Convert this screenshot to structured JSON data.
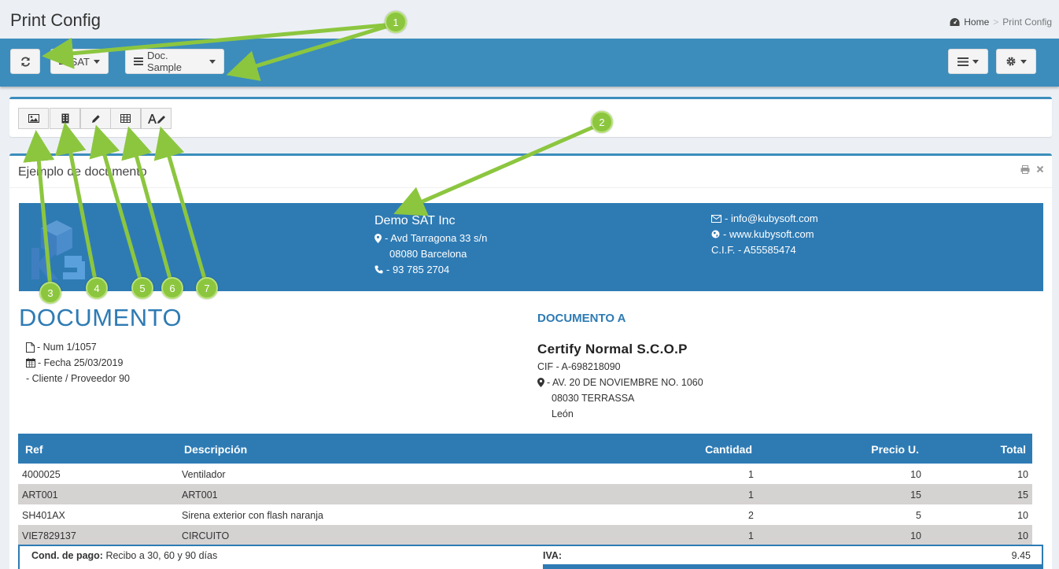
{
  "page": {
    "title": "Print Config",
    "breadcrumb": {
      "home": "Home",
      "current": "Print Config"
    }
  },
  "toolbar": {
    "sat_label": "SAT",
    "doc_label": "Doc. Sample"
  },
  "document_box": {
    "title": "Ejemplo de documento"
  },
  "company": {
    "name": "Demo SAT Inc",
    "address": "- Avd Tarragona 33 s/n",
    "city": "08080 Barcelona",
    "phone": "- 93 785 2704",
    "email": "- info@kubysoft.com",
    "web": "- www.kubysoft.com",
    "cif": "C.I.F. - A55585474"
  },
  "document": {
    "title": "DOCUMENTO",
    "num": "- Num 1/1057",
    "date": "- Fecha 25/03/2019",
    "client": "- Cliente / Proveedor 90"
  },
  "recipient": {
    "label": "DOCUMENTO A",
    "name": "Certify Normal S.C.O.P",
    "cif": "CIF - A-698218090",
    "address": "- AV. 20 DE NOVIEMBRE NO. 1060",
    "city": "08030 TERRASSA",
    "region": "León"
  },
  "items": {
    "headers": [
      "Ref",
      "Descripción",
      "Cantidad",
      "Precio U.",
      "Total"
    ],
    "rows": [
      [
        "4000025",
        "Ventilador",
        "1",
        "10",
        "10"
      ],
      [
        "ART001",
        "ART001",
        "1",
        "15",
        "15"
      ],
      [
        "SH401AX",
        "Sirena exterior con flash naranja",
        "2",
        "5",
        "10"
      ],
      [
        "VIE7829137",
        "CIRCUITO",
        "1",
        "10",
        "10"
      ]
    ]
  },
  "totals": {
    "payment_label": "Cond. de pago:",
    "payment_value": "Recibo a 30, 60 y 90 días",
    "iva_label": "IVA:",
    "iva_value": "9.45"
  },
  "callouts": [
    "1",
    "2",
    "3",
    "4",
    "5",
    "6",
    "7"
  ],
  "colors": {
    "primary": "#3c8dbc",
    "band": "#2e7bb4",
    "callout": "#8cc63f"
  }
}
